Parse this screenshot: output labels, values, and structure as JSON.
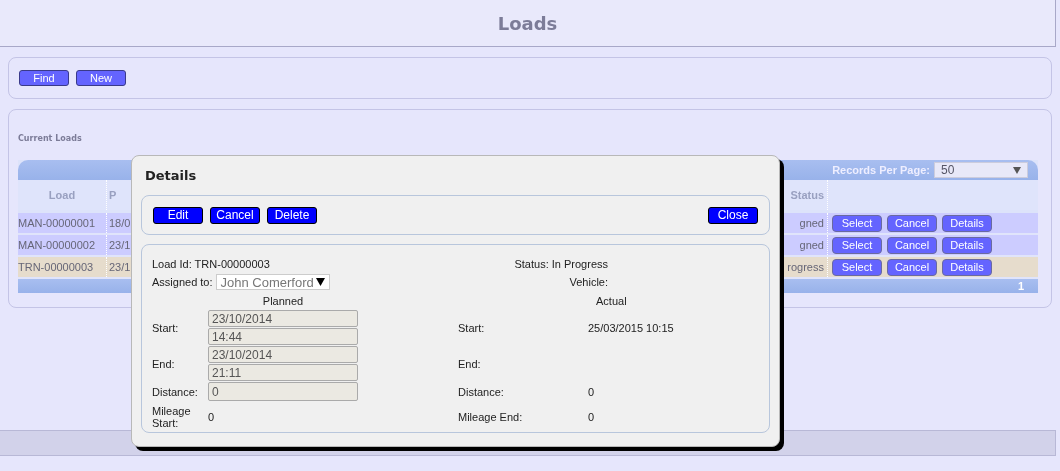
{
  "page_title": "Loads",
  "toolbar": {
    "buttons": [
      "Find",
      "New"
    ]
  },
  "current_loads": {
    "title": "Current Loads",
    "records_per_page": {
      "label": "Records Per Page:",
      "value": "50"
    },
    "columns": [
      {
        "label": "Load"
      },
      {
        "label": "P"
      },
      {
        "label": "Status"
      }
    ],
    "rows": [
      {
        "load": "MAN-00000001",
        "column_2": "18/0",
        "status": "gned",
        "selected": false,
        "actions": [
          "Select",
          "Cancel",
          "Details"
        ]
      },
      {
        "load": "MAN-00000002",
        "column_2": "23/1",
        "status": "gned",
        "selected": false,
        "actions": [
          "Select",
          "Cancel",
          "Details"
        ]
      },
      {
        "load": "TRN-00000003",
        "column_2": "23/1",
        "status": "rogress",
        "selected": true,
        "actions": [
          "Select",
          "Cancel",
          "Details"
        ]
      }
    ],
    "pager": "1"
  },
  "dialog": {
    "title": "Details",
    "actions": [
      "Edit",
      "Cancel",
      "Delete"
    ],
    "close": "Close",
    "load_id": "Load Id: TRN-00000003",
    "status": "Status: In Progress",
    "assigned_label": "Assigned to:",
    "assigned_value": "John Comerford",
    "vehicle": "Vehicle:",
    "planned": {
      "heading": "Planned",
      "start_label": "Start:",
      "start_date": "23/10/2014",
      "start_time": "14:44",
      "end_label": "End:",
      "end_date": "23/10/2014",
      "end_time": "21:11",
      "distance_label": "Distance:",
      "distance": "0",
      "mileage_label": "Mileage Start:",
      "mileage": "0"
    },
    "actual": {
      "heading": "Actual",
      "start_label": "Start:",
      "start": "25/03/2015 10:15",
      "end_label": "End:",
      "distance_label": "Distance:",
      "distance": "0",
      "mileage_label": "Mileage End:",
      "mileage": "0"
    }
  }
}
